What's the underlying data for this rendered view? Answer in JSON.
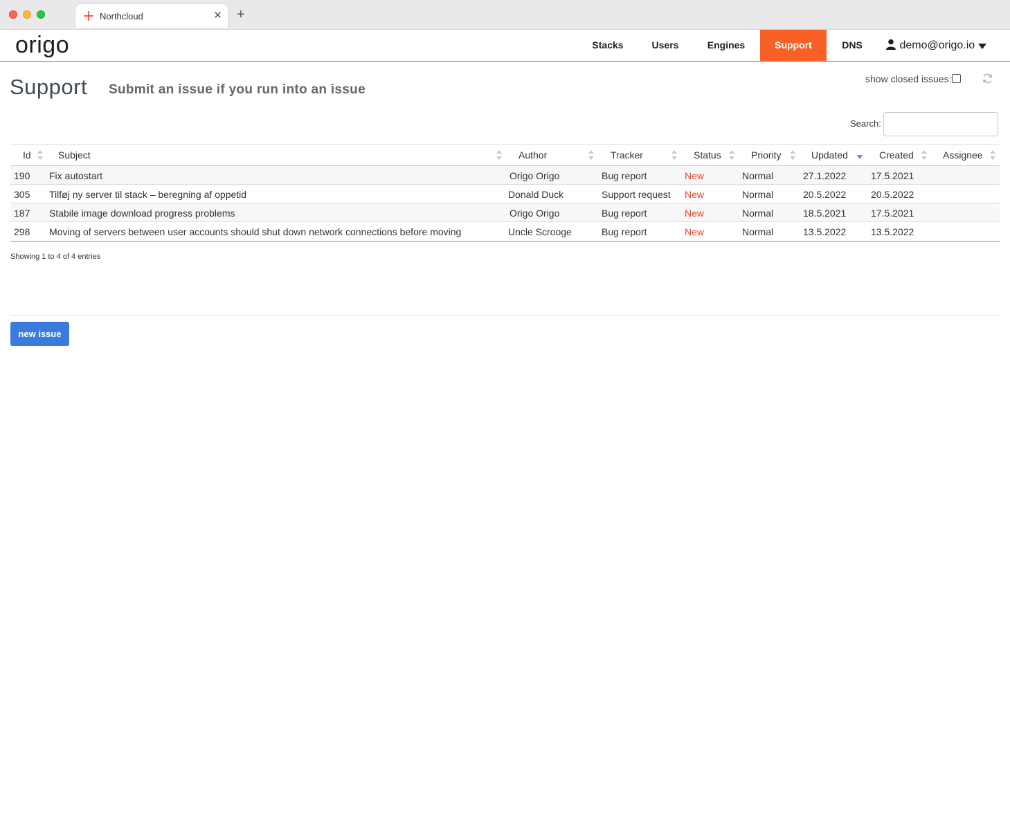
{
  "browser": {
    "tab_title": "Northcloud",
    "close_glyph": "✕",
    "newtab_glyph": "+"
  },
  "nav": {
    "logo": "origo",
    "items": [
      "Stacks",
      "Users",
      "Engines",
      "Support",
      "DNS"
    ],
    "active": "Support",
    "user": "demo@origo.io",
    "accent": "#f96026"
  },
  "header": {
    "title": "Support",
    "subtitle": "Submit an issue if you run into an issue",
    "show_closed_label": "show closed issues:",
    "show_closed_checked": false
  },
  "search": {
    "label": "Search:",
    "value": ""
  },
  "table": {
    "columns": [
      "Id",
      "Subject",
      "Author",
      "Tracker",
      "Status",
      "Priority",
      "Updated",
      "Created",
      "Assignee"
    ],
    "sorted_by": "Updated",
    "rows": [
      {
        "id": "190",
        "subject": "Fix autostart",
        "author": "Origo Origo",
        "tracker": "Bug report",
        "status": "New",
        "priority": "Normal",
        "updated": "27.1.2022",
        "created": "17.5.2021",
        "assignee": ""
      },
      {
        "id": "305",
        "subject": "Tilføj ny server til stack – beregning af oppetid",
        "author": "Donald Duck",
        "tracker": "Support request",
        "status": "New",
        "priority": "Normal",
        "updated": "20.5.2022",
        "created": "20.5.2022",
        "assignee": ""
      },
      {
        "id": "187",
        "subject": "Stabile image download progress problems",
        "author": "Origo Origo",
        "tracker": "Bug report",
        "status": "New",
        "priority": "Normal",
        "updated": "18.5.2021",
        "created": "17.5.2021",
        "assignee": ""
      },
      {
        "id": "298",
        "subject": "Moving of servers between user accounts should shut down network connections before moving",
        "author": "Uncle Scrooge",
        "tracker": "Bug report",
        "status": "New",
        "priority": "Normal",
        "updated": "13.5.2022",
        "created": "13.5.2022",
        "assignee": ""
      }
    ],
    "info": "Showing 1 to 4 of 4 entries",
    "status_color": "#e8422b"
  },
  "actions": {
    "new_issue": "new issue",
    "button_color": "#3b7bdd"
  }
}
